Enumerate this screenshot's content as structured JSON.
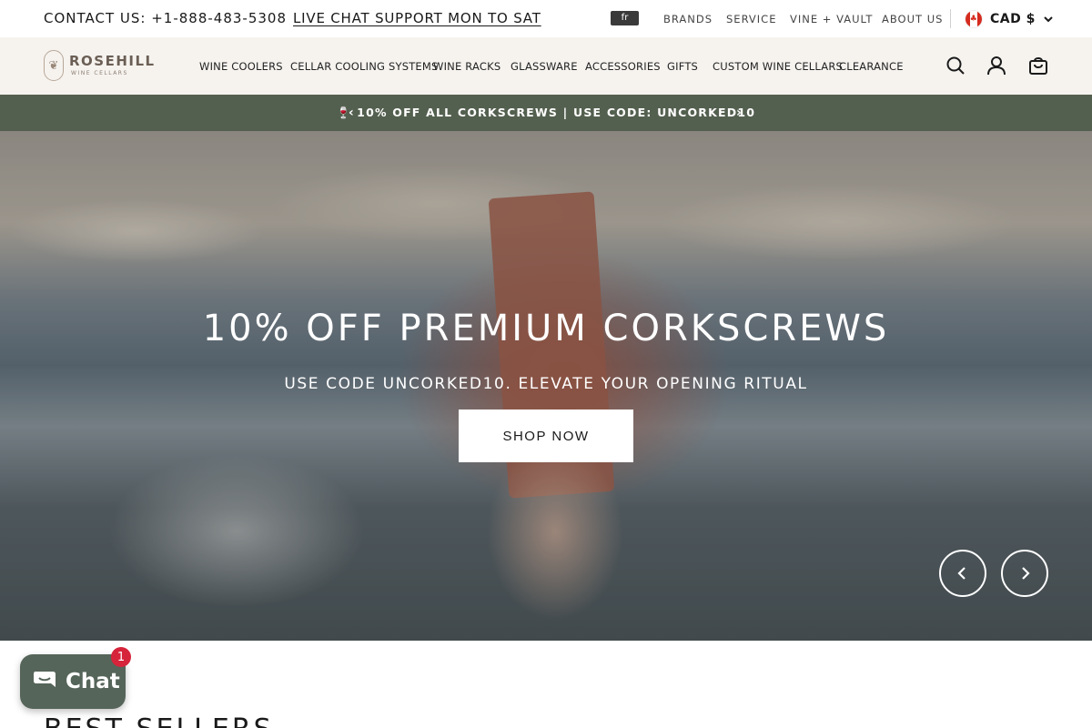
{
  "topbar": {
    "contact": "CONTACT US: +1-888-483-5308",
    "chat_support": "LIVE CHAT SUPPORT MON TO SAT",
    "language": "fr",
    "links": [
      "BRANDS",
      "SERVICE",
      "VINE + VAULT",
      "ABOUT US"
    ],
    "currency": "CAD $"
  },
  "header": {
    "logo_name": "ROSEHILL",
    "logo_tag": "WINE CELLARS",
    "nav": [
      "WINE COOLERS",
      "CELLAR COOLING SYSTEMS",
      "WINE RACKS",
      "GLASSWARE",
      "ACCESSORIES",
      "GIFTS",
      "CUSTOM WINE CELLARS",
      "CLEARANCE"
    ],
    "icons": [
      "search-icon",
      "account-icon",
      "cart-icon"
    ]
  },
  "announcement": {
    "message": "🍷 10% OFF ALL CORKSCREWS | USE CODE: UNCORKED10",
    "prev": "‹",
    "next": "›"
  },
  "hero": {
    "title": "10% OFF PREMIUM CORKSCREWS",
    "subtitle": "USE CODE UNCORKED10. ELEVATE YOUR OPENING RITUAL",
    "cta": "SHOP NOW",
    "prev": "‹",
    "next": "›"
  },
  "section": {
    "title": "BEST SELLERS"
  },
  "chat_widget": {
    "label": "Chat",
    "badge": "1"
  },
  "colors": {
    "announcement_bg": "#54604f",
    "header_bg": "#f6f3ef",
    "chat_bg": "#56655a",
    "badge": "#d6243b"
  }
}
